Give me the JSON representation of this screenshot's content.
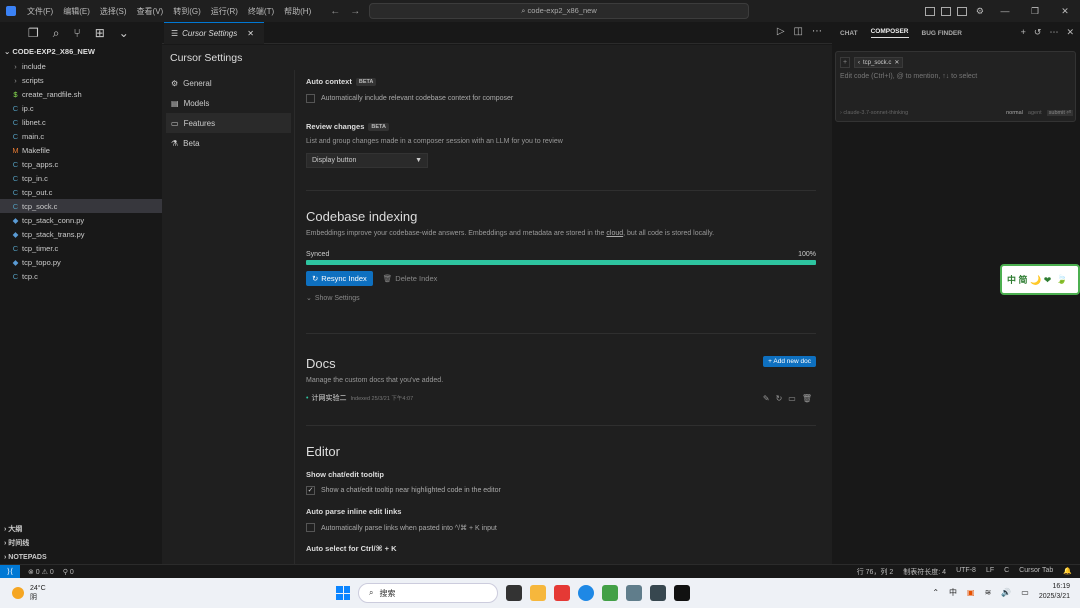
{
  "titlebar": {
    "menus": [
      "文件(F)",
      "编辑(E)",
      "选择(S)",
      "查看(V)",
      "转到(G)",
      "运行(R)",
      "终端(T)",
      "帮助(H)"
    ],
    "search_text": "code-exp2_x86_new"
  },
  "explorer": {
    "title": "CODE-EXP2_X86_NEW",
    "items": [
      {
        "name": "include",
        "type": "folder"
      },
      {
        "name": "scripts",
        "type": "folder"
      },
      {
        "name": "create_randfile.sh",
        "type": "sh"
      },
      {
        "name": "ip.c",
        "type": "c"
      },
      {
        "name": "libnet.c",
        "type": "c"
      },
      {
        "name": "main.c",
        "type": "c"
      },
      {
        "name": "Makefile",
        "type": "make"
      },
      {
        "name": "tcp_apps.c",
        "type": "c"
      },
      {
        "name": "tcp_in.c",
        "type": "c"
      },
      {
        "name": "tcp_out.c",
        "type": "c"
      },
      {
        "name": "tcp_sock.c",
        "type": "c",
        "active": true
      },
      {
        "name": "tcp_stack_conn.py",
        "type": "py"
      },
      {
        "name": "tcp_stack_trans.py",
        "type": "py"
      },
      {
        "name": "tcp_timer.c",
        "type": "c"
      },
      {
        "name": "tcp_topo.py",
        "type": "py"
      },
      {
        "name": "tcp.c",
        "type": "c"
      }
    ],
    "sections": [
      "大纲",
      "时间线",
      "NOTEPADS"
    ]
  },
  "tab": {
    "label": "Cursor Settings"
  },
  "settings": {
    "title": "Cursor Settings",
    "nav": [
      {
        "label": "General",
        "icon": "gear-icon"
      },
      {
        "label": "Models",
        "icon": "bars-icon"
      },
      {
        "label": "Features",
        "icon": "document-icon"
      },
      {
        "label": "Beta",
        "icon": "flask-icon"
      }
    ],
    "auto_context": {
      "title": "Auto context",
      "badge": "BETA",
      "desc": "Automatically include relevant codebase context for composer"
    },
    "review_changes": {
      "title": "Review changes",
      "badge": "BETA",
      "desc": "List and group changes made in a composer session with an LLM for you to review",
      "select_value": "Display button"
    },
    "indexing": {
      "title": "Codebase indexing",
      "desc_before": "Embeddings improve your codebase-wide answers. Embeddings and metadata are stored in the",
      "desc_link": "cloud",
      "desc_after": ", but all code is stored locally.",
      "status": "Synced",
      "percent_text": "100%",
      "progress": 1.0,
      "resync_label": "Resync Index",
      "delete_label": "Delete Index",
      "show_settings_label": "Show Settings"
    },
    "docs": {
      "title": "Docs",
      "add_label": "+ Add new doc",
      "desc": "Manage the custom docs that you've added.",
      "entries": [
        {
          "name": "计网实验二",
          "meta": "Indexed 25/3/21 下午4:07"
        }
      ]
    },
    "editor": {
      "title": "Editor",
      "tooltip_title": "Show chat/edit tooltip",
      "tooltip_desc": "Show a chat/edit tooltip near highlighted code in the editor",
      "parse_title": "Auto parse inline edit links",
      "parse_desc": "Automatically parse links when pasted into ^/⌘ + K input",
      "autoselect_title": "Auto select for Ctrl/⌘ + K"
    }
  },
  "right_panel": {
    "tabs": [
      "CHAT",
      "COMPOSER",
      "BUG FINDER"
    ],
    "active_tab": "COMPOSER",
    "chip": "tcp_sock.c",
    "placeholder": "Edit code (Ctrl+I), @ to mention, ↑↓ to select",
    "model": "› claude-3.7-sonnet-thinking",
    "mode_normal": "normal",
    "mode_agent": "agent",
    "submit": "submit ⏎"
  },
  "widget": {
    "text": "中 简 🌙 ❤"
  },
  "statusbar": {
    "errors": "⊗ 0 ⚠ 0",
    "ports": "⚲ 0",
    "position": "行 76，列 2",
    "tabsize": "制表符长度: 4",
    "encoding": "UTF-8",
    "eol": "LF",
    "lang": "C",
    "cursor_tab": "Cursor Tab"
  },
  "taskbar": {
    "temp": "24°C",
    "weather": "阴",
    "search": "搜索",
    "ime": "中",
    "time": "16:19",
    "date": "2025/3/21"
  }
}
